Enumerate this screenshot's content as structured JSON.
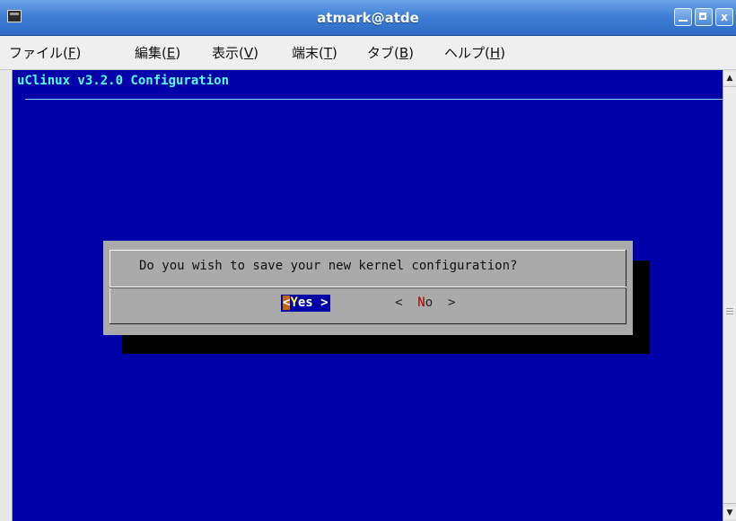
{
  "window": {
    "title": "atmark@atde",
    "minimize_icon": "minimize-icon",
    "maximize_icon": "maximize-icon",
    "close_label": "x"
  },
  "menu": {
    "items": [
      {
        "label": "ファイル(",
        "accel": "F",
        "suffix": ")"
      },
      {
        "label": "編集(",
        "accel": "E",
        "suffix": ")"
      },
      {
        "label": "表示(",
        "accel": "V",
        "suffix": ")"
      },
      {
        "label": "端末(",
        "accel": "T",
        "suffix": ")"
      },
      {
        "label": "タブ(",
        "accel": "B",
        "suffix": ")"
      },
      {
        "label": "ヘルプ(",
        "accel": "H",
        "suffix": ")"
      }
    ]
  },
  "terminal": {
    "title": "uClinux v3.2.0 Configuration",
    "colors": {
      "background": "#0000a8",
      "title": "#55ffff"
    }
  },
  "dialog": {
    "question": "Do you wish to save your new kernel configuration?",
    "yes": {
      "left": "<",
      "hot": "Y",
      "rest": "es >"
    },
    "no": {
      "left": "<  ",
      "hot": "N",
      "rest": "o  >"
    }
  }
}
